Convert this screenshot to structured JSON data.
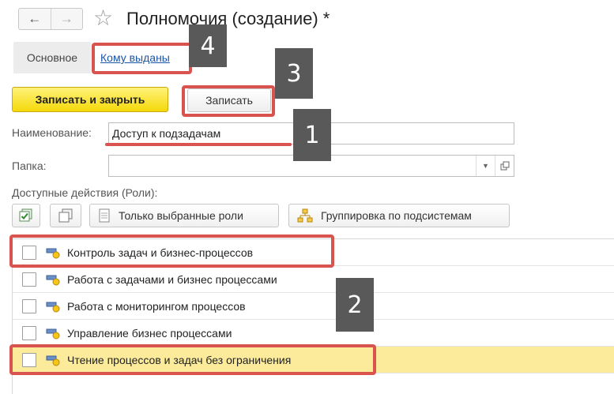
{
  "header": {
    "back_icon": "arrow-left-icon",
    "forward_icon": "arrow-right-icon",
    "favorite_icon": "star-outline-icon",
    "title": "Полномочия (создание) *"
  },
  "tabs": {
    "main_label": "Основное",
    "link_label": "Кому выданы"
  },
  "toolbar": {
    "save_close_label": "Записать и закрыть",
    "save_label": "Записать"
  },
  "form": {
    "name_label": "Наименование:",
    "name_value": "Доступ к подзадачам",
    "folder_label": "Папка:",
    "folder_value": "",
    "roles_label": "Доступные действия (Роли):"
  },
  "roles_toolbar": {
    "check_all_icon": "check-all-icon",
    "uncheck_all_icon": "uncheck-all-icon",
    "only_selected_label": "Только выбранные роли",
    "group_subsystems_label": "Группировка по подсистемам"
  },
  "roles": [
    {
      "label": "Контроль задач и бизнес-процессов",
      "checked": false
    },
    {
      "label": "Работа с задачами и бизнес процессами",
      "checked": false
    },
    {
      "label": "Работа с мониторингом процессов",
      "checked": false
    },
    {
      "label": "Управление бизнес процессами",
      "checked": false
    },
    {
      "label": "Чтение процессов и задач без ограничения",
      "checked": false
    }
  ],
  "annotations": {
    "badge1": "1",
    "badge2": "2",
    "badge3": "3",
    "badge4": "4"
  },
  "colors": {
    "accent_yellow": "#f5d90a",
    "selected_row": "#fbeb9a",
    "annotation_red": "#d9534f",
    "badge_gray": "#595959",
    "link_blue": "#1a56a8"
  }
}
